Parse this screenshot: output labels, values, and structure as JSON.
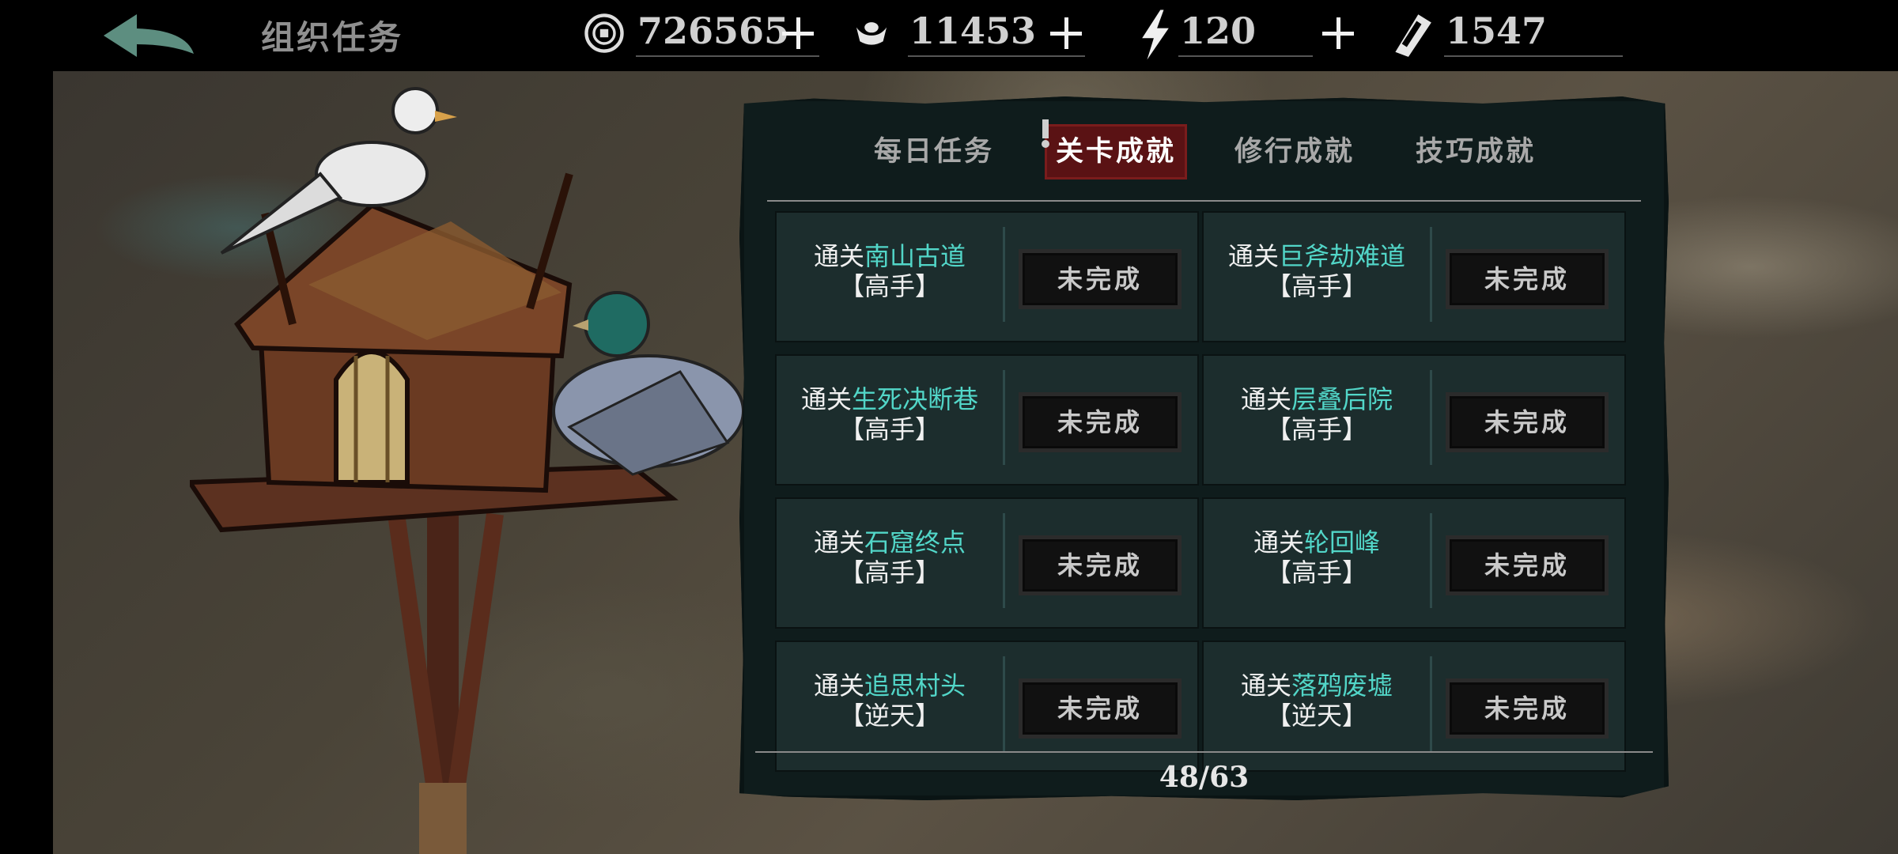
{
  "header": {
    "title": "组织任务",
    "resources": [
      {
        "icon": "coin-icon",
        "value": "726565"
      },
      {
        "icon": "ingot-icon",
        "value": "11453"
      },
      {
        "icon": "lightning-icon",
        "value": "120"
      },
      {
        "icon": "ticket-icon",
        "value": "1547"
      }
    ]
  },
  "tabs": [
    "每日任务",
    "关卡成就",
    "修行成就",
    "技巧成就"
  ],
  "active_tab": "关卡成就",
  "achievements": [
    {
      "prefix": "通关",
      "place": "南山古道",
      "difficulty": "【高手】",
      "status": "未完成"
    },
    {
      "prefix": "通关",
      "place": "巨斧劫难道",
      "difficulty": "【高手】",
      "status": "未完成"
    },
    {
      "prefix": "通关",
      "place": "生死决断巷",
      "difficulty": "【高手】",
      "status": "未完成"
    },
    {
      "prefix": "通关",
      "place": "层叠后院",
      "difficulty": "【高手】",
      "status": "未完成"
    },
    {
      "prefix": "通关",
      "place": "石窟终点",
      "difficulty": "【高手】",
      "status": "未完成"
    },
    {
      "prefix": "通关",
      "place": "轮回峰",
      "difficulty": "【高手】",
      "status": "未完成"
    },
    {
      "prefix": "通关",
      "place": "追思村头",
      "difficulty": "【逆天】",
      "status": "未完成"
    },
    {
      "prefix": "通关",
      "place": "落鸦废墟",
      "difficulty": "【逆天】",
      "status": "未完成"
    }
  ],
  "progress": "48/63",
  "colors": {
    "accent_teal": "#52d6c8",
    "active_tab_red": "#5a1214"
  }
}
